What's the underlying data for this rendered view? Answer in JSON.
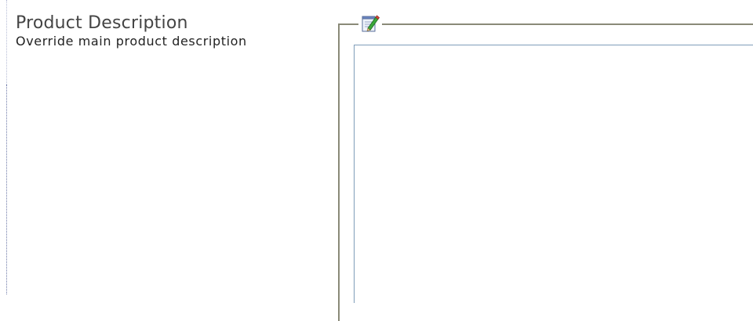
{
  "field": {
    "title": "Product Description",
    "subtitle": "Override main product description"
  },
  "editor": {
    "icon": "edit-note-icon",
    "value": ""
  }
}
